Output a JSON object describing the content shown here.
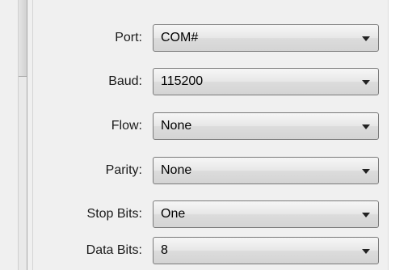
{
  "form": {
    "fields": [
      {
        "label": "Port:",
        "value": "COM#"
      },
      {
        "label": "Baud:",
        "value": "115200"
      },
      {
        "label": "Flow:",
        "value": "None"
      },
      {
        "label": "Parity:",
        "value": "None"
      },
      {
        "label": "Stop Bits:",
        "value": "One"
      },
      {
        "label": "Data Bits:",
        "value": "8"
      }
    ]
  },
  "icons": {
    "dropdown": "chevron-down-icon"
  }
}
